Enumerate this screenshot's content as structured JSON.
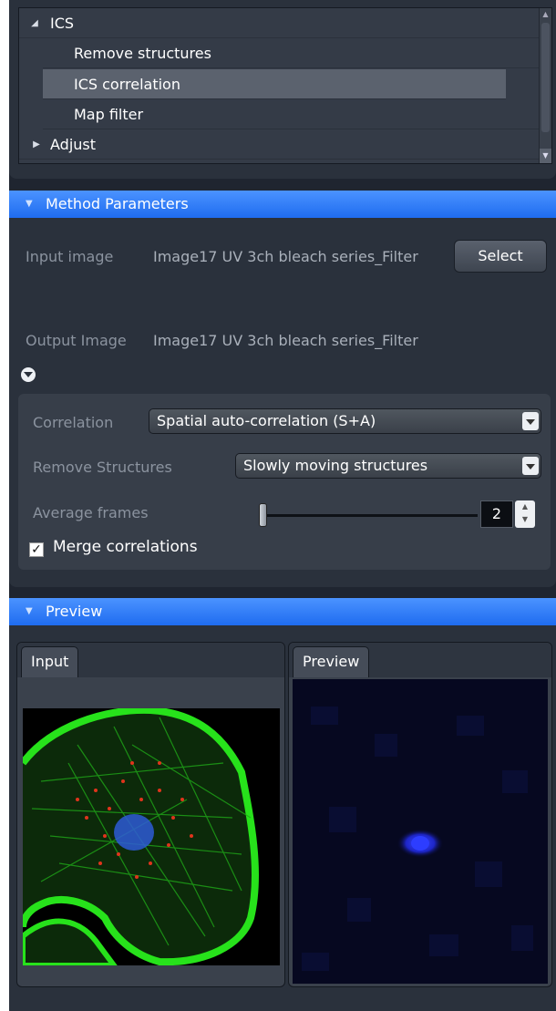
{
  "tree": {
    "items": [
      {
        "label": "ICS",
        "expanded": true,
        "level": 0
      },
      {
        "label": "Remove structures",
        "level": 1
      },
      {
        "label": "ICS correlation",
        "level": 1,
        "selected": true
      },
      {
        "label": "Map filter",
        "level": 1
      },
      {
        "label": "Adjust",
        "expanded": false,
        "level": 0
      }
    ]
  },
  "method_parameters": {
    "title": "Method Parameters",
    "input_label": "Input image",
    "input_value": "Image17 UV 3ch bleach series_Filter",
    "select_button": "Select",
    "output_label": "Output Image",
    "output_value": "Image17 UV 3ch bleach series_Filter",
    "correlation_label": "Correlation",
    "correlation_value": "Spatial auto-correlation (S+A)",
    "remove_structures_label": "Remove Structures",
    "remove_structures_value": "Slowly moving structures",
    "average_frames_label": "Average frames",
    "average_frames_value": "2",
    "merge_label": "Merge correlations",
    "merge_checked": true
  },
  "preview": {
    "title": "Preview",
    "input_tab": "Input",
    "preview_tab": "Preview"
  },
  "colors": {
    "accent": "#2f7cf6",
    "panel": "#2a313c",
    "background": "#1f2530"
  }
}
